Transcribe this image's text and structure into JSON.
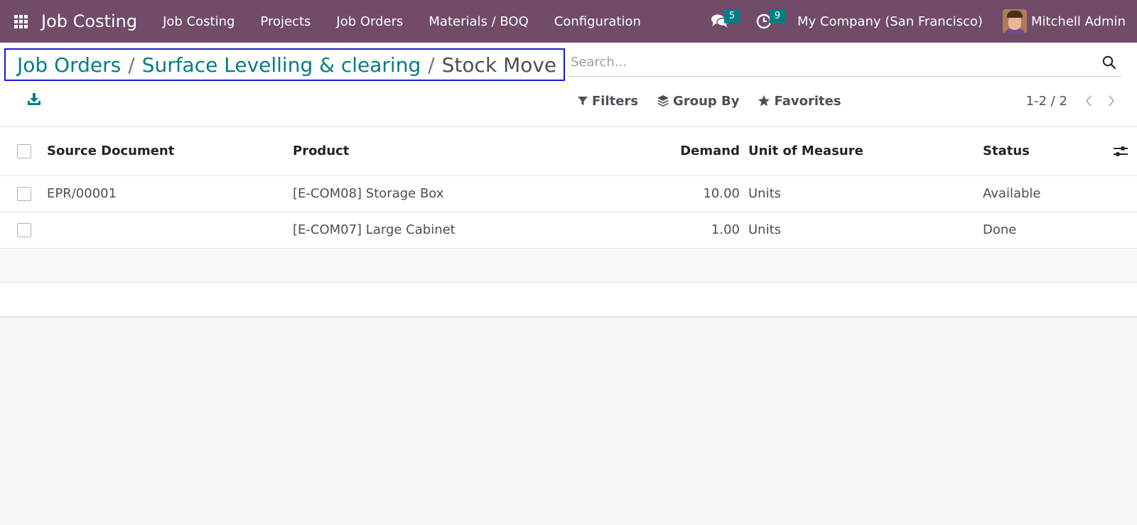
{
  "navbar": {
    "brand": "Job Costing",
    "menu": [
      "Job Costing",
      "Projects",
      "Job Orders",
      "Materials / BOQ",
      "Configuration"
    ],
    "messages_count": "5",
    "activities_count": "9",
    "company": "My Company (San Francisco)",
    "user_name": "Mitchell Admin",
    "brand_color": "#714b67",
    "badge_color": "#017e84"
  },
  "breadcrumb": {
    "items": [
      "Job Orders",
      "Surface Levelling & clearing"
    ],
    "current": "Stock Move",
    "separator": "/"
  },
  "search": {
    "placeholder": "Search...",
    "value": ""
  },
  "filters": {
    "filters_label": "Filters",
    "group_by_label": "Group By",
    "favorites_label": "Favorites"
  },
  "pager": {
    "value": "1-2 / 2"
  },
  "table": {
    "columns": [
      "Source Document",
      "Product",
      "Demand",
      "Unit of Measure",
      "Status"
    ],
    "rows": [
      {
        "source": "EPR/00001",
        "product": "[E-COM08] Storage Box",
        "demand": "10.00",
        "uom": "Units",
        "status": "Available"
      },
      {
        "source": "",
        "product": "[E-COM07] Large Cabinet",
        "demand": "1.00",
        "uom": "Units",
        "status": "Done"
      }
    ]
  },
  "icons": {
    "apps": "apps-grid-icon",
    "messages": "chat-bubbles-icon",
    "activities": "clock-icon",
    "search": "search-icon",
    "download": "download-icon",
    "filter": "filter-funnel-icon",
    "group_by": "layers-icon",
    "favorites": "star-icon",
    "optional_columns": "sliders-icon"
  }
}
